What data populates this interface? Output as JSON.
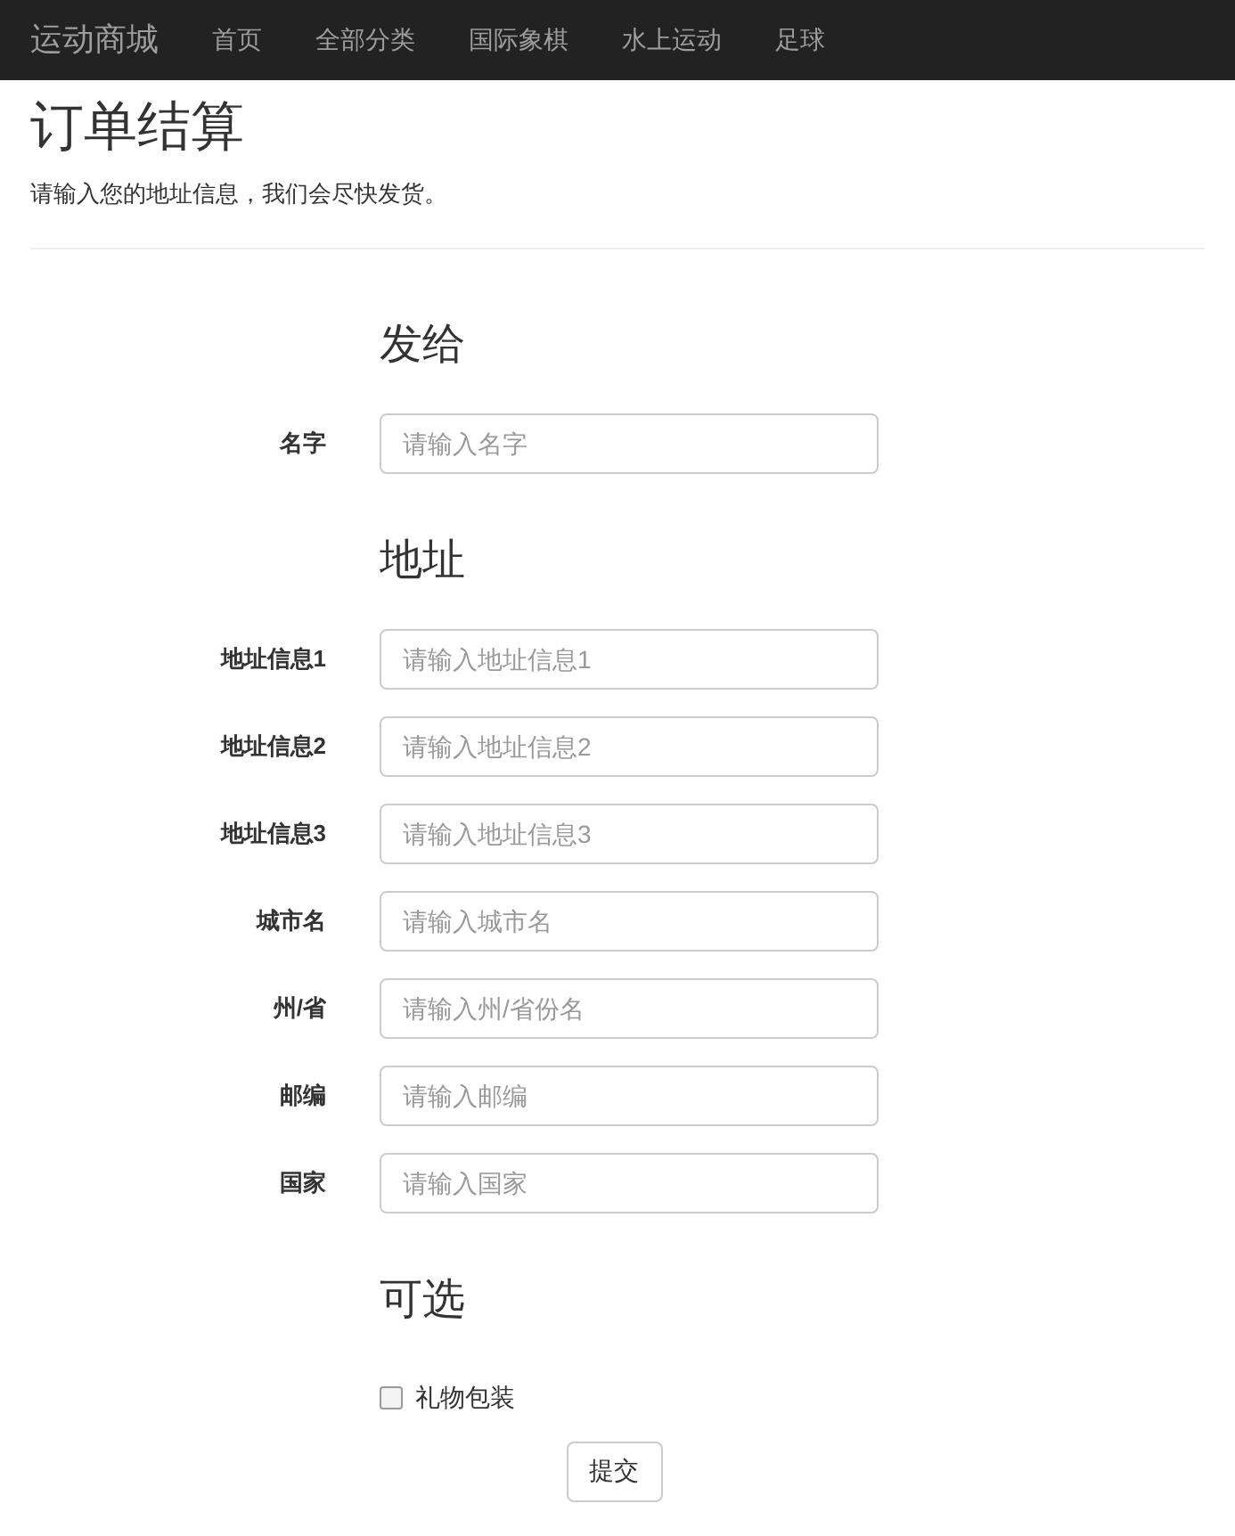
{
  "navbar": {
    "brand": "运动商城",
    "links": [
      "首页",
      "全部分类",
      "国际象棋",
      "水上运动",
      "足球"
    ]
  },
  "header": {
    "title": "订单结算",
    "subtitle": "请输入您的地址信息，我们会尽快发货。"
  },
  "sections": [
    {
      "heading": "发给",
      "fields": [
        {
          "label": "名字",
          "placeholder": "请输入名字"
        }
      ]
    },
    {
      "heading": "地址",
      "fields": [
        {
          "label": "地址信息1",
          "placeholder": "请输入地址信息1"
        },
        {
          "label": "地址信息2",
          "placeholder": "请输入地址信息2"
        },
        {
          "label": "地址信息3",
          "placeholder": "请输入地址信息3"
        },
        {
          "label": "城市名",
          "placeholder": "请输入城市名"
        },
        {
          "label": "州/省",
          "placeholder": "请输入州/省份名"
        },
        {
          "label": "邮编",
          "placeholder": "请输入邮编"
        },
        {
          "label": "国家",
          "placeholder": "请输入国家"
        }
      ]
    },
    {
      "heading": "可选",
      "options": [
        {
          "label": "礼物包装",
          "checked": false
        }
      ]
    }
  ],
  "submit": "提交"
}
